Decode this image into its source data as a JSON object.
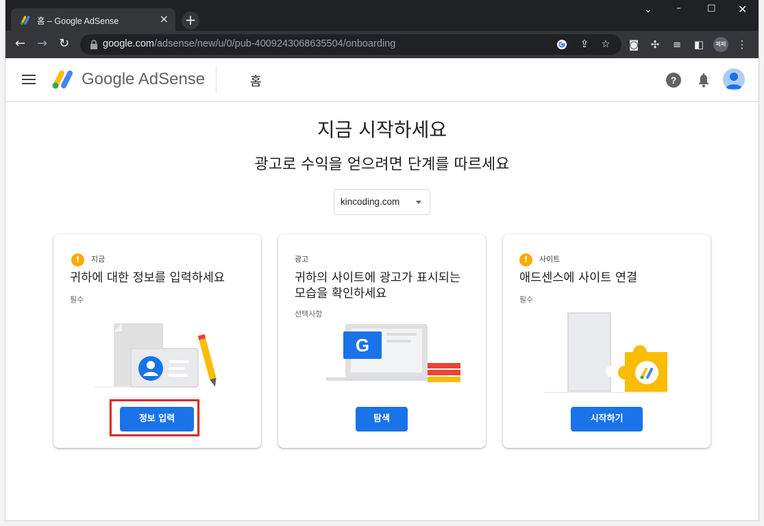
{
  "browser": {
    "tab_title": "홈 – Google AdSense",
    "url_host": "google.com",
    "url_path": "/adsense/new/u/0/pub-4009243068635504/onboarding",
    "profile_label": "페페"
  },
  "header": {
    "brand": "Google AdSense",
    "page_name": "홈"
  },
  "main": {
    "title": "지금 시작하세요",
    "subtitle": "광고로 수익을 얻으려면 단계를 따르세요",
    "site_select": "kincoding.com"
  },
  "cards": [
    {
      "tag": "지금",
      "heading": "귀하에 대한 정보를 입력하세요",
      "requirement": "필수",
      "button": "정보 입력",
      "status_color": "#f9ab00"
    },
    {
      "tag": "광고",
      "heading": "귀하의 사이트에 광고가 표시되는 모습을 확인하세요",
      "requirement": "선택사항",
      "button": "탐색"
    },
    {
      "tag": "사이트",
      "heading": "애드센스에 사이트 연결",
      "requirement": "필수",
      "button": "시작하기",
      "status_color": "#f9ab00"
    }
  ],
  "colors": {
    "accent": "#1a73e8",
    "warning": "#f9ab00",
    "highlight": "#d93025"
  }
}
